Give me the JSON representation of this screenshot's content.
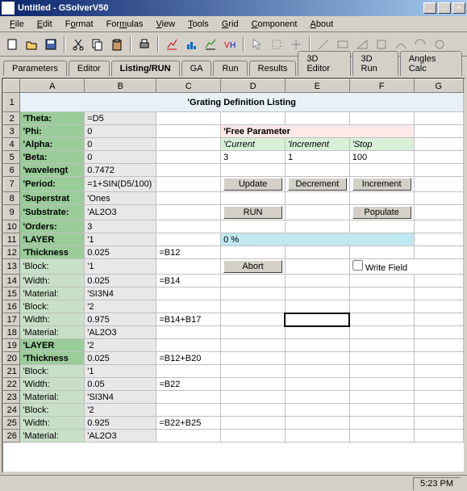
{
  "title": "Untitled - GSolverV50",
  "menus": [
    "File",
    "Edit",
    "Format",
    "Formulas",
    "View",
    "Tools",
    "Grid",
    "Component",
    "About"
  ],
  "tabs": [
    "Parameters",
    "Editor",
    "Listing/RUN",
    "GA",
    "Run",
    "Results",
    "3D Editor",
    "3D Run",
    "Angles Calc"
  ],
  "activeTab": 2,
  "cols": [
    "A",
    "B",
    "C",
    "D",
    "E",
    "F",
    "G"
  ],
  "gridTitle": "'Grating Definition Listing",
  "freeParam": {
    "header": "'Free Parameter",
    "current": "'Current",
    "increment": "'Increment",
    "stop": "'Stop"
  },
  "buttons": {
    "update": "Update",
    "decrement": "Decrement",
    "increment": "Increment",
    "run": "RUN",
    "populate": "Populate",
    "abort": "Abort",
    "writeField": "Write Field"
  },
  "progress": "0 %",
  "rows": {
    "2": {
      "label": "'Theta:",
      "B": "=D5"
    },
    "3": {
      "label": "'Phi:",
      "B": "0"
    },
    "4": {
      "label": "'Alpha:",
      "B": "0"
    },
    "5": {
      "label": "'Beta:",
      "B": "0",
      "D": "3",
      "E": "1",
      "F": "100"
    },
    "6": {
      "label": "'wavelengt",
      "B": "0.7472"
    },
    "7": {
      "label": "'Period:",
      "B": "=1+SIN(D5/100)"
    },
    "8": {
      "label": "'Superstrat",
      "B": "'Ones"
    },
    "9": {
      "label": "'Substrate:",
      "B": "'AL2O3"
    },
    "10": {
      "label": "'Orders:",
      "B": "3"
    },
    "11": {
      "label": "'LAYER",
      "B": "'1"
    },
    "12": {
      "label": "'Thickness",
      "B": "0.025",
      "C": "=B12"
    },
    "13": {
      "label": "'Block:",
      "B": "'1"
    },
    "14": {
      "label": "'Width:",
      "B": "0.025",
      "C": "=B14"
    },
    "15": {
      "label": "'Material:",
      "B": "'SI3N4"
    },
    "16": {
      "label": "'Block:",
      "B": "'2"
    },
    "17": {
      "label": "'Width:",
      "B": "0.975",
      "C": "=B14+B17"
    },
    "18": {
      "label": "'Material:",
      "B": "'AL2O3"
    },
    "19": {
      "label": "'LAYER",
      "B": "'2"
    },
    "20": {
      "label": "'Thickness",
      "B": "0.025",
      "C": "=B12+B20"
    },
    "21": {
      "label": "'Block:",
      "B": "'1"
    },
    "22": {
      "label": "'Width:",
      "B": "0.05",
      "C": "=B22"
    },
    "23": {
      "label": "'Material:",
      "B": "'SI3N4"
    },
    "24": {
      "label": "'Block:",
      "B": "'2"
    },
    "25": {
      "label": "'Width:",
      "B": "0.925",
      "C": "=B22+B25"
    },
    "26": {
      "label": "'Material:",
      "B": "'AL2O3"
    }
  },
  "status": {
    "time": "5:23 PM"
  }
}
